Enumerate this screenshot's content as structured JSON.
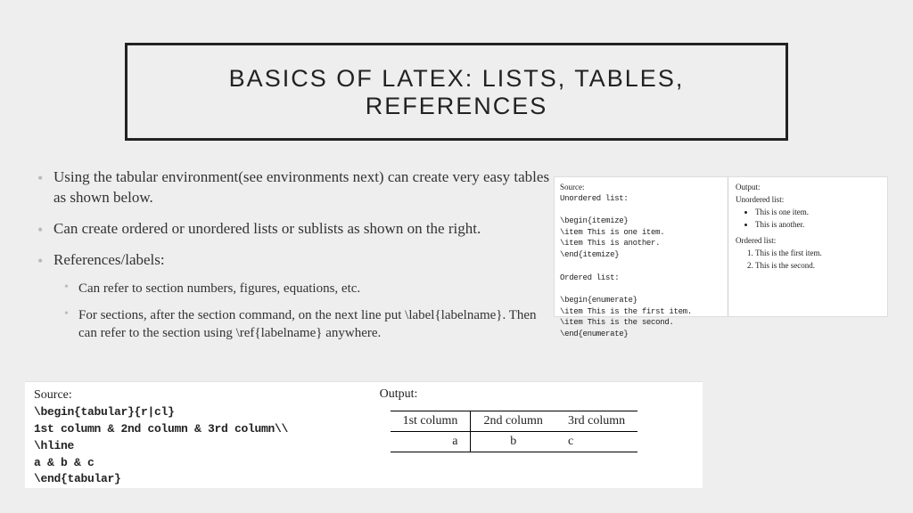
{
  "title": "BASICS OF LATEX: LISTS, TABLES, REFERENCES",
  "bullets": {
    "b1": "Using the tabular environment(see environments next) can create very easy tables as shown below.",
    "b2": "Can create ordered or unordered lists or sublists as shown on the right.",
    "b3": "References/labels:",
    "b3a": "Can refer to section numbers, figures, equations, etc.",
    "b3b": "For sections, after the section command, on the next line put \\label{labelname}. Then can refer to the section using \\ref{labelname} anywhere."
  },
  "lists_example": {
    "source_label": "Source:",
    "output_label": "Output:",
    "src_lines": {
      "l0": "Unordered list:",
      "l1": "",
      "l2": "\\begin{itemize}",
      "l3": "\\item This is one item.",
      "l4": "\\item This is another.",
      "l5": "\\end{itemize}",
      "l6": "",
      "l7": "Ordered list:",
      "l8": "",
      "l9": "\\begin{enumerate}",
      "l10": "\\item This is the first item.",
      "l11": "\\item This is the second.",
      "l12": "\\end{enumerate}"
    },
    "out": {
      "u_label": "Unordered list:",
      "u1": "This is one item.",
      "u2": "This is another.",
      "o_label": "Ordered list:",
      "o1": "This is the first item.",
      "o2": "This is the second."
    }
  },
  "tabular_example": {
    "source_label": "Source:",
    "output_label": "Output:",
    "src": {
      "l1": "\\begin{tabular}{r|cl}",
      "l2": "1st column & 2nd column & 3rd column\\\\",
      "l3": "\\hline",
      "l4": "a & b & c",
      "l5": "\\end{tabular}"
    },
    "table": {
      "r1c1": "1st column",
      "r1c2": "2nd column",
      "r1c3": "3rd column",
      "r2c1": "a",
      "r2c2": "b",
      "r2c3": "c"
    }
  },
  "chart_data": {
    "type": "table",
    "title": "LaTeX tabular example output",
    "columns": [
      "1st column",
      "2nd column",
      "3rd column"
    ],
    "rows": [
      [
        "a",
        "b",
        "c"
      ]
    ],
    "alignment": [
      "right",
      "center",
      "left"
    ]
  }
}
